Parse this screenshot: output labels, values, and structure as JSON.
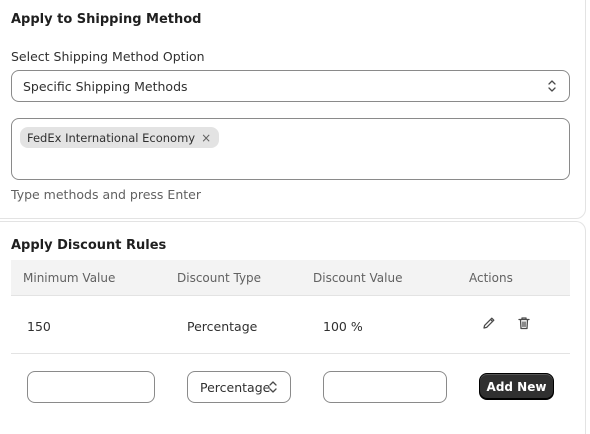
{
  "shipping": {
    "title": "Apply to Shipping Method",
    "select_label": "Select Shipping Method Option",
    "select_value": "Specific Shipping Methods",
    "tags": [
      "FedEx International Economy"
    ],
    "tag_remove": "×",
    "help_text": "Type methods and press Enter"
  },
  "rules": {
    "title": "Apply Discount Rules",
    "columns": [
      "Minimum Value",
      "Discount Type",
      "Discount Value",
      "Actions"
    ],
    "rows": [
      {
        "min": "150",
        "type": "Percentage",
        "value": "100 %"
      }
    ],
    "new_row": {
      "min_value": "",
      "type_value": "Percentage",
      "discount_value": "",
      "add_label": "Add New"
    }
  },
  "icons": {
    "select_arrow": "chevron-up-down-icon",
    "edit": "pencil-icon",
    "delete": "trash-icon"
  },
  "colors": {
    "primary_button": "#303030",
    "border": "#8a8a8a",
    "header_bg": "#f3f3f3"
  }
}
